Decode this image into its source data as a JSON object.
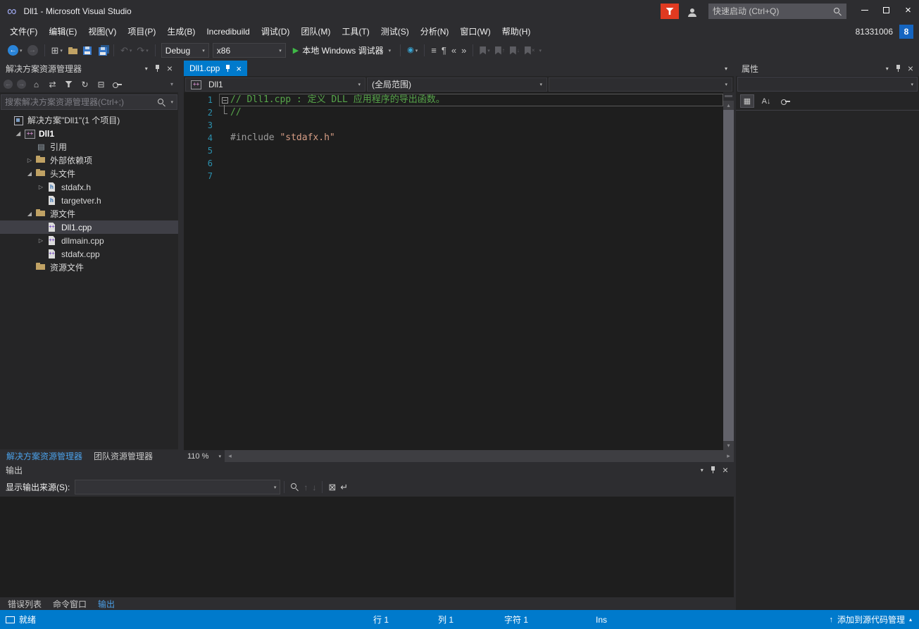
{
  "window": {
    "title": "Dll1 - Microsoft Visual Studio",
    "quick_launch_placeholder": "快速启动 (Ctrl+Q)",
    "account_id": "81331006",
    "account_badge": "8"
  },
  "menu": {
    "items": [
      {
        "name": "file",
        "label": "文件(F)"
      },
      {
        "name": "edit",
        "label": "编辑(E)"
      },
      {
        "name": "view",
        "label": "视图(V)"
      },
      {
        "name": "project",
        "label": "项目(P)"
      },
      {
        "name": "build",
        "label": "生成(B)"
      },
      {
        "name": "incredibuild",
        "label": "Incredibuild"
      },
      {
        "name": "debug",
        "label": "调试(D)"
      },
      {
        "name": "team",
        "label": "团队(M)"
      },
      {
        "name": "tools",
        "label": "工具(T)"
      },
      {
        "name": "test",
        "label": "测试(S)"
      },
      {
        "name": "analyze",
        "label": "分析(N)"
      },
      {
        "name": "window",
        "label": "窗口(W)"
      },
      {
        "name": "help",
        "label": "帮助(H)"
      }
    ]
  },
  "toolbar": {
    "configuration": "Debug",
    "platform": "x86",
    "start_label": "本地 Windows 调试器"
  },
  "solution_explorer": {
    "title": "解决方案资源管理器",
    "search_placeholder": "搜索解决方案资源管理器(Ctrl+;)",
    "tree": [
      {
        "name": "solution",
        "label": "解决方案\"Dll1\"(1 个项目)",
        "icon": "solution",
        "indent": 0,
        "expander": "none"
      },
      {
        "name": "project-dll1",
        "label": "Dll1",
        "icon": "project",
        "indent": 1,
        "expander": "expanded",
        "bold": true
      },
      {
        "name": "references",
        "label": "引用",
        "icon": "references",
        "indent": 2,
        "expander": "none"
      },
      {
        "name": "external-dependencies",
        "label": "外部依赖项",
        "icon": "folder",
        "indent": 2,
        "expander": "collapsed"
      },
      {
        "name": "header-files",
        "label": "头文件",
        "icon": "folder",
        "indent": 2,
        "expander": "expanded"
      },
      {
        "name": "stdafx-h",
        "label": "stdafx.h",
        "icon": "header",
        "indent": 3,
        "expander": "collapsed"
      },
      {
        "name": "targetver-h",
        "label": "targetver.h",
        "icon": "header",
        "indent": 3,
        "expander": "none"
      },
      {
        "name": "source-files",
        "label": "源文件",
        "icon": "folder",
        "indent": 2,
        "expander": "expanded"
      },
      {
        "name": "dll1-cpp",
        "label": "Dll1.cpp",
        "icon": "cpp",
        "indent": 3,
        "expander": "none",
        "selected": true
      },
      {
        "name": "dllmain-cpp",
        "label": "dllmain.cpp",
        "icon": "cpp",
        "indent": 3,
        "expander": "collapsed"
      },
      {
        "name": "stdafx-cpp",
        "label": "stdafx.cpp",
        "icon": "cpp",
        "indent": 3,
        "expander": "none"
      },
      {
        "name": "resource-files",
        "label": "资源文件",
        "icon": "folder",
        "indent": 2,
        "expander": "none"
      }
    ],
    "tabs": [
      {
        "name": "solution-explorer",
        "label": "解决方案资源管理器",
        "active": true
      },
      {
        "name": "team-explorer",
        "label": "团队资源管理器",
        "active": false
      }
    ]
  },
  "editor": {
    "tab_label": "Dll1.cpp",
    "nav_project": "Dll1",
    "nav_scope": "(全局范围)",
    "nav_member": "",
    "zoom": "110 %",
    "lines": [
      {
        "num": 1,
        "outline": "box",
        "current": true,
        "tokens": [
          {
            "type": "comment",
            "text": "// Dll1.cpp : 定义 DLL 应用程序的导出函数。"
          }
        ]
      },
      {
        "num": 2,
        "outline": "guide",
        "tokens": [
          {
            "type": "comment",
            "text": "//"
          }
        ]
      },
      {
        "num": 3,
        "tokens": []
      },
      {
        "num": 4,
        "tokens": [
          {
            "type": "preproc",
            "text": "#include"
          },
          {
            "type": "plain",
            "text": " "
          },
          {
            "type": "string",
            "text": "\"stdafx.h\""
          }
        ]
      },
      {
        "num": 5,
        "tokens": []
      },
      {
        "num": 6,
        "tokens": []
      },
      {
        "num": 7,
        "tokens": []
      }
    ]
  },
  "properties": {
    "title": "属性"
  },
  "output": {
    "title": "输出",
    "source_label": "显示输出来源(S):",
    "tabs": [
      {
        "name": "error-list",
        "label": "错误列表",
        "active": false
      },
      {
        "name": "command-window",
        "label": "命令窗口",
        "active": false
      },
      {
        "name": "output",
        "label": "输出",
        "active": true
      }
    ]
  },
  "status": {
    "ready": "就绪",
    "line": "行 1",
    "col": "列 1",
    "char": "字符 1",
    "mode": "Ins",
    "source_control": "添加到源代码管理"
  },
  "colors": {
    "accent": "#007acc",
    "editor_bg": "#1e1e1e",
    "comment": "#57a64a",
    "string": "#d69d85"
  }
}
